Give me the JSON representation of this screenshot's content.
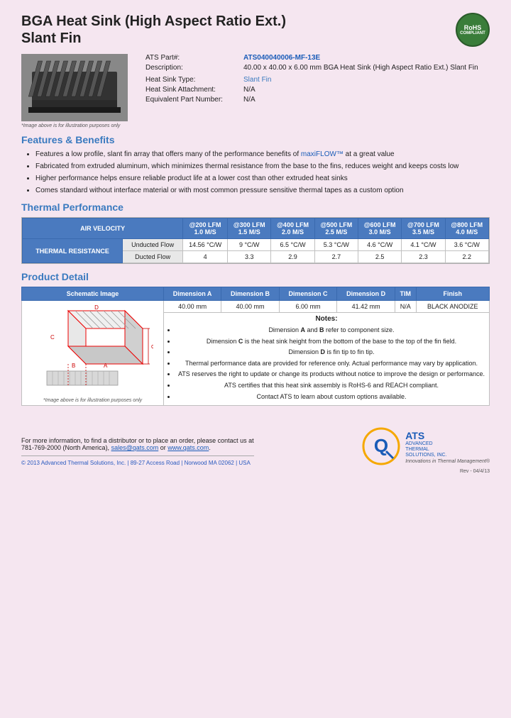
{
  "header": {
    "title_line1": "BGA Heat Sink (High Aspect Ratio Ext.)",
    "title_line2": "Slant Fin",
    "rohs": "RoHS\nCOMPLIANT"
  },
  "product_specs": {
    "part_label": "ATS Part#:",
    "part_value": "ATS040040006-MF-13E",
    "desc_label": "Description:",
    "desc_value": "40.00 x 40.00 x 6.00 mm BGA Heat Sink (High Aspect Ratio Ext.) Slant Fin",
    "type_label": "Heat Sink Type:",
    "type_value": "Slant Fin",
    "attachment_label": "Heat Sink Attachment:",
    "attachment_value": "N/A",
    "equiv_label": "Equivalent Part Number:",
    "equiv_value": "N/A"
  },
  "image_note": "*Image above is for illustration purposes only",
  "features": {
    "heading": "Features & Benefits",
    "items": [
      "Features a low profile, slant fin array that offers many of the performance benefits of maxiFLOW™ at a great value",
      "Fabricated from extruded aluminum, which minimizes thermal resistance from the base to the fins, reduces weight and keeps costs low",
      "Higher performance helps ensure reliable product life at a lower cost than other extruded heat sinks",
      "Comes standard without interface material or with most common pressure sensitive thermal tapes as a custom option"
    ],
    "highlight_text": "maxiFLOW™"
  },
  "thermal_performance": {
    "heading": "Thermal Performance",
    "table": {
      "col_header_main": "AIR VELOCITY",
      "columns": [
        {
          "lfm": "@200 LFM",
          "ms": "1.0 M/S"
        },
        {
          "lfm": "@300 LFM",
          "ms": "1.5 M/S"
        },
        {
          "lfm": "@400 LFM",
          "ms": "2.0 M/S"
        },
        {
          "lfm": "@500 LFM",
          "ms": "2.5 M/S"
        },
        {
          "lfm": "@600 LFM",
          "ms": "3.0 M/S"
        },
        {
          "lfm": "@700 LFM",
          "ms": "3.5 M/S"
        },
        {
          "lfm": "@800 LFM",
          "ms": "4.0 M/S"
        }
      ],
      "row_label": "THERMAL RESISTANCE",
      "rows": [
        {
          "label": "Unducted Flow",
          "values": [
            "14.56 °C/W",
            "9 °C/W",
            "6.5 °C/W",
            "5.3 °C/W",
            "4.6 °C/W",
            "4.1 °C/W",
            "3.6 °C/W"
          ]
        },
        {
          "label": "Ducted Flow",
          "values": [
            "4",
            "3.3",
            "2.9",
            "2.7",
            "2.5",
            "2.3",
            "2.2"
          ]
        }
      ]
    }
  },
  "product_detail": {
    "heading": "Product Detail",
    "table_headers": [
      "Schematic Image",
      "Dimension A",
      "Dimension B",
      "Dimension C",
      "Dimension D",
      "TIM",
      "Finish"
    ],
    "dimension_values": [
      "40.00 mm",
      "40.00 mm",
      "6.00 mm",
      "41.42 mm",
      "N/A",
      "BLACK ANODIZE"
    ],
    "notes_heading": "Notes:",
    "notes": [
      "Dimension A and B refer to component size.",
      "Dimension C is the heat sink height from the bottom of the base to the top of the fin field.",
      "Dimension D is fin tip to fin tip.",
      "Thermal performance data are provided for reference only. Actual performance may vary by application.",
      "ATS reserves the right to update or change its products without notice to improve the design or performance.",
      "ATS certifies that this heat sink assembly is RoHS-6 and REACH compliant.",
      "Contact ATS to learn about custom options available."
    ],
    "image_note": "*Image above is for illustration purposes only"
  },
  "footer": {
    "contact_text": "For more information, to find a distributor or to place an order, please contact us at",
    "phone": "781-769-2000 (North America),",
    "email": "sales@qats.com",
    "or_text": "or",
    "website": "www.qats.com",
    "copyright": "© 2013 Advanced Thermal Solutions, Inc. | 89-27 Access Road | Norwood MA  02062 | USA",
    "rev": "Rev - 04/4/13",
    "ats_name_line1": "ADVANCED",
    "ats_name_line2": "THERMAL",
    "ats_name_line3": "SOLUTIONS, INC.",
    "ats_tagline": "Innovations in Thermal Management®"
  }
}
